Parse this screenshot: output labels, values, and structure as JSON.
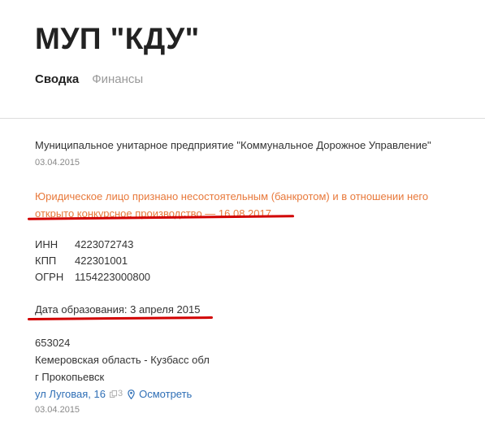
{
  "header": {
    "title": "МУП \"КДУ\"",
    "tabs": [
      {
        "label": "Сводка",
        "active": true
      },
      {
        "label": "Финансы",
        "active": false
      }
    ]
  },
  "company": {
    "full_name": "Муниципальное унитарное предприятие \"Коммунальное Дорожное Управление\"",
    "full_name_date": "03.04.2015",
    "bankruptcy_notice_line1": "Юридическое лицо признано несостоятельным (банкротом) и в отношении него",
    "bankruptcy_notice_line2": "открыто конкурсное производство — 16.08.2017",
    "codes": [
      {
        "label": "ИНН",
        "value": "4223072743"
      },
      {
        "label": "КПП",
        "value": "422301001"
      },
      {
        "label": "ОГРН",
        "value": "1154223000800"
      }
    ],
    "founded_label": "Дата образования:",
    "founded_value": "3 апреля 2015"
  },
  "address": {
    "postal_code": "653024",
    "region": "Кемеровская область - Кузбасс обл",
    "city": "г Прокопьевск",
    "street": "ул Луговая, 16",
    "same_address_count": "3",
    "inspect_label": "Осмотреть",
    "date": "03.04.2015"
  },
  "colors": {
    "notice": "#e8793b",
    "link": "#2f6fb6",
    "highlight_underline": "#d10000"
  }
}
